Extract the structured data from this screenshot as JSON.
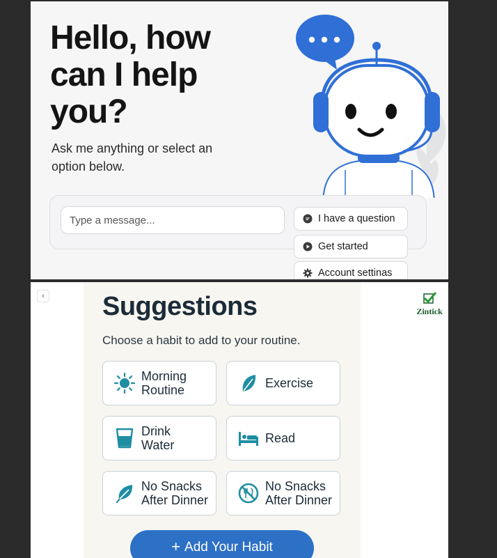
{
  "top_panel": {
    "heading": "Hello, how can I help you?",
    "subheading": "Ask me anything or select an option below.",
    "message_placeholder": "Type a message...",
    "chips": [
      {
        "label": "I have a question",
        "icon": "chat-bubble-icon"
      },
      {
        "label": "Get started",
        "icon": "play-icon"
      },
      {
        "label": "Account settinas",
        "icon": "gear-icon"
      }
    ],
    "mascot": "robot-mascot-with-headset",
    "speech_bubble_icon": "ellipsis-speech-bubble-icon",
    "colors": {
      "accent": "#2f6fd6",
      "background": "#f6f6f7"
    }
  },
  "bottom_panel": {
    "back_label": "‹",
    "logo_text": "Zintick",
    "title": "Suggestions",
    "subtitle": "Choose a habit to add to your routine.",
    "habits": [
      {
        "label_lines": [
          "Morning",
          "Routine"
        ],
        "icon": "sun-icon"
      },
      {
        "label_lines": [
          "Exercise"
        ],
        "icon": "leaf-icon"
      },
      {
        "label_lines": [
          "Drink",
          "Water"
        ],
        "icon": "water-glass-icon"
      },
      {
        "label_lines": [
          "Read"
        ],
        "icon": "bed-icon"
      },
      {
        "label_lines": [
          "No Snacks",
          "After Dinner"
        ],
        "icon": "leaf-icon"
      },
      {
        "label_lines": [
          "No Snacks",
          "After Dinner"
        ],
        "icon": "no-food-icon"
      }
    ],
    "add_button": {
      "plus": "+",
      "label": "Add Your Habit"
    },
    "colors": {
      "teal_icon": "#1f8ea3",
      "button": "#2d71c6",
      "title": "#1c2b38"
    }
  }
}
